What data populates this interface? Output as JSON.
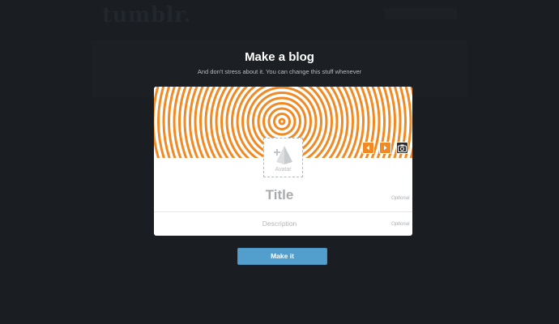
{
  "brand": {
    "logo_text": "tumblr."
  },
  "page": {
    "heading": "Make a blog",
    "subheading": "And don't stress about it. You can change this stuff whenever"
  },
  "card": {
    "header_icon_prev": "chevron-left-icon",
    "header_icon_next": "chevron-right-icon",
    "header_icon_camera": "camera-icon",
    "avatar_label": "Avatar",
    "avatar_icon": "pyramid-add-icon",
    "title_placeholder": "Title",
    "title_optional": "Optional",
    "description_placeholder": "Description",
    "description_optional": "Optional"
  },
  "actions": {
    "make_it_label": "Make it"
  },
  "colors": {
    "background": "#1a1d21",
    "header_orange": "#f08a24",
    "button_blue": "#529ecc"
  }
}
